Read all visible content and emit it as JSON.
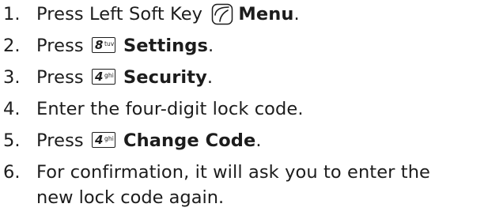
{
  "steps": [
    {
      "num": "1.",
      "before": "Press Left Soft Key",
      "icon": "left-soft-key-icon",
      "label": "Menu",
      "after": "."
    },
    {
      "num": "2.",
      "before": "Press",
      "key": {
        "digit": "8",
        "letters": "tuv"
      },
      "label": "Settings",
      "after": "."
    },
    {
      "num": "3.",
      "before": "Press",
      "key": {
        "digit": "4",
        "letters": "ghi"
      },
      "label": "Security",
      "after": "."
    },
    {
      "num": "4.",
      "text": "Enter the four-digit lock code."
    },
    {
      "num": "5.",
      "before": "Press",
      "key": {
        "digit": "4",
        "letters": "ghi"
      },
      "label": "Change Code",
      "after": "."
    },
    {
      "num": "6.",
      "text": "For confirmation, it will ask you to enter the",
      "continuation": "new lock code again."
    }
  ]
}
